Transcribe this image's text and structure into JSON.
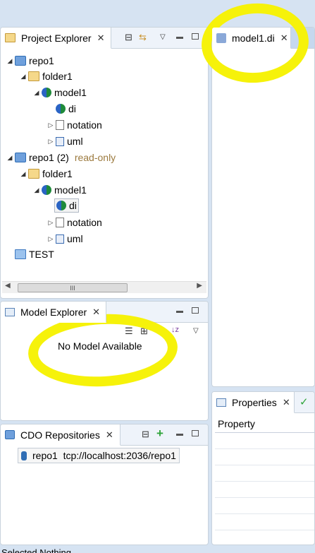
{
  "project_explorer": {
    "title": "Project Explorer",
    "tree": [
      {
        "label": "repo1",
        "icon": "repo-icon"
      },
      {
        "label": "folder1",
        "icon": "folder-icon"
      },
      {
        "label": "model1",
        "icon": "model-icon"
      },
      {
        "label": "di",
        "icon": "model-icon"
      },
      {
        "label": "notation",
        "icon": "notation-icon"
      },
      {
        "label": "uml",
        "icon": "uml-icon"
      },
      {
        "label": "repo1 (2)",
        "suffix": "read-only",
        "icon": "repo-icon"
      },
      {
        "label": "folder1",
        "icon": "folder-icon"
      },
      {
        "label": "model1",
        "icon": "model-icon"
      },
      {
        "label": "di",
        "icon": "model-icon"
      },
      {
        "label": "notation",
        "icon": "notation-icon"
      },
      {
        "label": "uml",
        "icon": "uml-icon"
      },
      {
        "label": "TEST",
        "icon": "folder-icon"
      }
    ],
    "scroll_thumb": "III"
  },
  "editor": {
    "tab_label": "model1.di"
  },
  "model_explorer": {
    "title": "Model Explorer",
    "empty_message": "No Model Available"
  },
  "cdo": {
    "title": "CDO Repositories",
    "entry": "repo1  tcp://localhost:2036/repo1"
  },
  "properties": {
    "title": "Properties",
    "column": "Property"
  },
  "status_bar": {
    "text": "Selected Nothing"
  },
  "colors": {
    "highlight": "#f6f20a",
    "read_only": "#9c7a3e"
  }
}
